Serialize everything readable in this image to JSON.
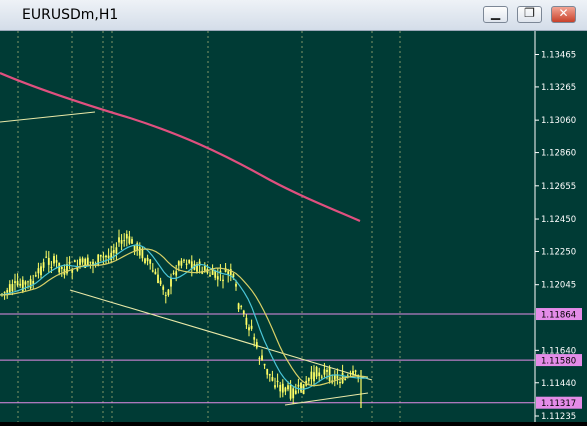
{
  "window": {
    "title": "EURUSDm,H1",
    "minimize_glyph": "▁",
    "restore_glyph": "❐",
    "close_glyph": "✕"
  },
  "colors": {
    "background": "#003b35",
    "candles": "#ffff66",
    "ma_long": "#e0507f",
    "ma_fast": "#4ac6d8",
    "ma_slow": "#d8d066",
    "trendline": "#e9e9a8",
    "hline": "#e48ce8"
  },
  "chart_data": {
    "type": "line",
    "price_axis": [
      "1.13465",
      "1.13265",
      "1.13060",
      "1.12860",
      "1.12655",
      "1.12450",
      "1.12250",
      "1.12045",
      "1.11640",
      "1.11440",
      "1.11235"
    ],
    "horizontal_lines": [
      {
        "label": "1.11864"
      },
      {
        "label": "1.11580"
      },
      {
        "label": "1.11317"
      }
    ],
    "y_range": [
      1.11235,
      1.13465
    ]
  },
  "price_labels": [
    "1.11864",
    "1.11580",
    "1.11317"
  ]
}
